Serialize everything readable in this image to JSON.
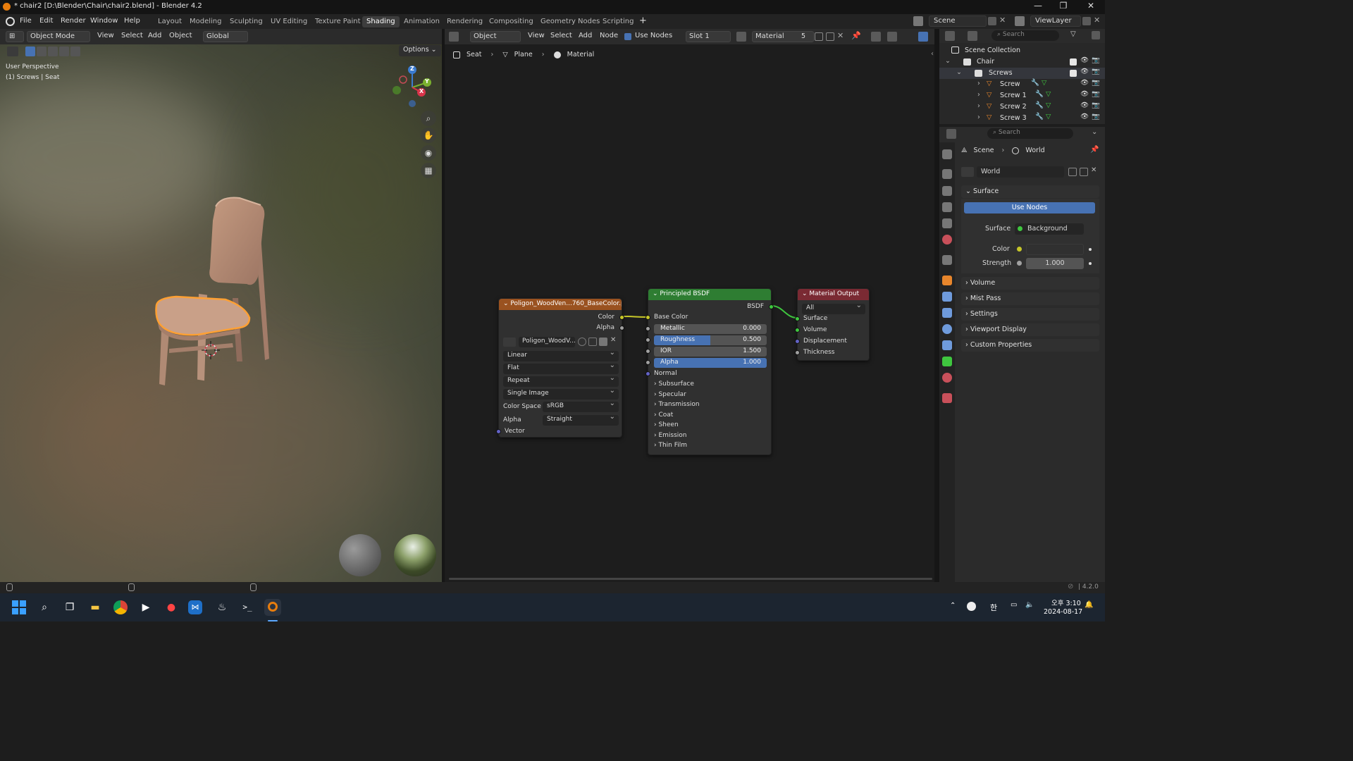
{
  "window": {
    "title": "* chair2 [D:\\Blender\\Chair\\chair2.blend] - Blender 4.2",
    "controls": [
      "—",
      "❐",
      "✕"
    ]
  },
  "menu": {
    "items": [
      "File",
      "Edit",
      "Render",
      "Window",
      "Help"
    ],
    "workspaces": [
      "Layout",
      "Modeling",
      "Sculpting",
      "UV Editing",
      "Texture Paint",
      "Shading",
      "Animation",
      "Rendering",
      "Compositing",
      "Geometry Nodes",
      "Scripting"
    ],
    "active_workspace": "Shading",
    "scene": "Scene",
    "view_layer": "ViewLayer"
  },
  "viewport_header": {
    "mode": "Object Mode",
    "menus": [
      "View",
      "Select",
      "Add",
      "Object"
    ],
    "orientation": "Global",
    "options": "Options"
  },
  "viewport": {
    "perspective": "User Perspective",
    "context": "(1) Screws | Seat",
    "gizmo": {
      "z": "Z",
      "y": "Y",
      "x": "X"
    }
  },
  "node_header": {
    "object_type": "Object",
    "menus": [
      "View",
      "Select",
      "Add",
      "Node"
    ],
    "use_nodes": "Use Nodes",
    "slot": "Slot 1",
    "material": "Material",
    "users": "5"
  },
  "breadcrumb": [
    "Seat",
    "Plane",
    "Material"
  ],
  "nodes": {
    "image_texture": {
      "title": "Poligon_WoodVen...760_BaseColor.png",
      "outputs": [
        "Color",
        "Alpha"
      ],
      "image_name": "Poligon_WoodV...",
      "interpolation": "Linear",
      "projection": "Flat",
      "extension": "Repeat",
      "source": "Single Image",
      "color_space_label": "Color Space",
      "color_space": "sRGB",
      "alpha_label": "Alpha",
      "alpha_mode": "Straight",
      "input": "Vector"
    },
    "bsdf": {
      "title": "Principled BSDF",
      "output": "BSDF",
      "base_color": "Base Color",
      "metallic": {
        "label": "Metallic",
        "value": "0.000",
        "fraction": 0.0
      },
      "roughness": {
        "label": "Roughness",
        "value": "0.500",
        "fraction": 0.5
      },
      "ior": {
        "label": "IOR",
        "value": "1.500",
        "fraction": 0.0
      },
      "alpha": {
        "label": "Alpha",
        "value": "1.000",
        "fraction": 1.0
      },
      "normal": "Normal",
      "panels": [
        "Subsurface",
        "Specular",
        "Transmission",
        "Coat",
        "Sheen",
        "Emission",
        "Thin Film"
      ]
    },
    "material_output": {
      "title": "Material Output",
      "target": "All",
      "inputs": [
        "Surface",
        "Volume",
        "Displacement",
        "Thickness"
      ]
    }
  },
  "outliner": {
    "search_placeholder": "Search",
    "root": "Scene Collection",
    "collections": [
      {
        "name": "Chair"
      },
      {
        "name": "Screws"
      }
    ],
    "objects": [
      "Screw",
      "Screw 1",
      "Screw 2",
      "Screw 3"
    ]
  },
  "properties": {
    "search_placeholder": "Search",
    "breadcrumb": [
      "Scene",
      "World"
    ],
    "world_name": "World",
    "surface_panel": "Surface",
    "use_nodes": "Use Nodes",
    "surface_label": "Surface",
    "surface_value": "Background",
    "color_label": "Color",
    "strength_label": "Strength",
    "strength_value": "1.000",
    "collapsed_panels": [
      "Volume",
      "Mist Pass",
      "Settings",
      "Viewport Display",
      "Custom Properties"
    ]
  },
  "status": {
    "version": "4.2.0"
  },
  "taskbar": {
    "time": "오후 3:10",
    "date": "2024-08-17",
    "ime": "한"
  },
  "colors": {
    "accent_blue": "#4772b3",
    "bsdf_header": "#2e7d32",
    "output_header": "#7a2a33",
    "texture_header": "#9a5220",
    "socket_yellow": "#c7c729",
    "socket_gray": "#a1a1a1",
    "socket_purple": "#6363c7",
    "socket_green": "#3fc63f",
    "selection_orange": "#ffa033"
  }
}
